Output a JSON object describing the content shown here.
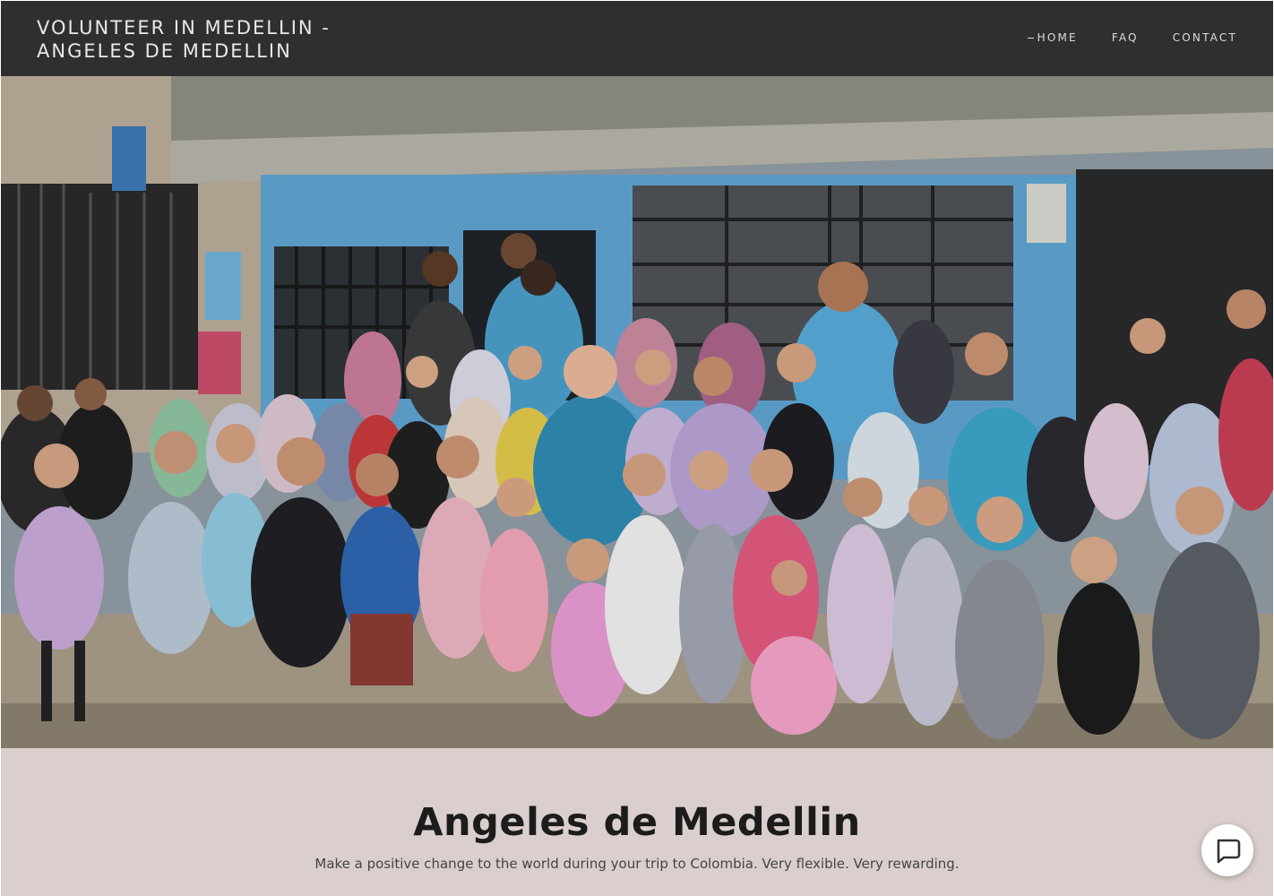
{
  "header": {
    "site_title_line1": "VOLUNTEER IN MEDELLIN -",
    "site_title_line2": "ANGELES DE MEDELLIN",
    "nav": [
      {
        "label": "HOME",
        "active": true
      },
      {
        "label": "FAQ",
        "active": false
      },
      {
        "label": "CONTACT",
        "active": false
      }
    ]
  },
  "hero": {
    "image": "group-photo-volunteers-and-children"
  },
  "intro": {
    "title": "Angeles de Medellin",
    "subtitle": "Make a positive change to the world during your trip to Colombia. Very flexible. Very rewarding."
  },
  "chat": {
    "icon": "chat-bubble-icon"
  },
  "colors": {
    "header_bg": "#2f2f2f",
    "intro_bg": "#dacfcc",
    "wall_blue": "#5ea3cf"
  }
}
